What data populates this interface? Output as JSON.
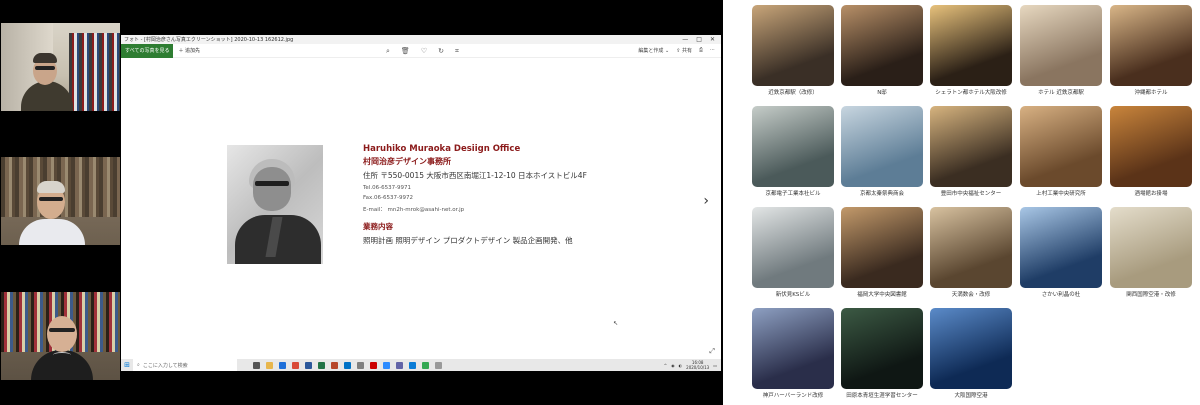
{
  "photos_window": {
    "title": "フォト - [村岡治彦さん写真エクリーンショット] 2020-10-13 162612.jpg",
    "all_photos_label": "すべての写真を見る",
    "add_label": "＋ 追加先",
    "edit_label": "編集と作成 ⌄",
    "share_label": "⇪ 共有",
    "minimize": "—",
    "maximize": "□",
    "close": "✕"
  },
  "card": {
    "name_en": "Haruhiko Muraoka Desiign Office",
    "name_jp": "村岡治彦デザイン事務所",
    "address": "住所 〒550-0015 大阪市西区南堀江1-12-10 日本ホイストビル4F",
    "tel": "Tel.06-6537-9971",
    "fax": "Fax.06-6537-9972",
    "email": "E-mail： mn2h-mrok@asahi-net.or.jp",
    "section_title": "業務内容",
    "business": "照明計画 照明デザイン プロダクトデザイン 製品企画開発、他"
  },
  "taskbar": {
    "search_placeholder": "ここに入力して検索",
    "time": "16:08",
    "date": "2020/10/13"
  },
  "gallery": {
    "items": [
      {
        "caption": "近鉄京都駅（改修）",
        "c1": "#3a2f26",
        "c2": "#c9a67a"
      },
      {
        "caption": "N邸",
        "c1": "#2a1f18",
        "c2": "#b89068"
      },
      {
        "caption": "シェラトン都ホテル大阪改修",
        "c1": "#2b2016",
        "c2": "#e8c27c"
      },
      {
        "caption": "ホテル 近鉄京都駅",
        "c1": "#8a7560",
        "c2": "#e7d8c0"
      },
      {
        "caption": "沖縄都ホテル",
        "c1": "#4a2f1e",
        "c2": "#d9b688"
      },
      {
        "caption": "京都電子工業本社ビル",
        "c1": "#4b5a5a",
        "c2": "#c6cdc9"
      },
      {
        "caption": "京都太秦祭典商会",
        "c1": "#5d7d96",
        "c2": "#c8d6e0"
      },
      {
        "caption": "豊田市中央福祉センター",
        "c1": "#3b2e22",
        "c2": "#d7b47f"
      },
      {
        "caption": "上村工業中央研究所",
        "c1": "#6b4a2c",
        "c2": "#d8b183"
      },
      {
        "caption": "酒場館お掛場",
        "c1": "#5b3318",
        "c2": "#c9853c"
      },
      {
        "caption": "新伏見KSビル",
        "c1": "#707a7e",
        "c2": "#e3e6e6"
      },
      {
        "caption": "福岡大学中央図書館",
        "c1": "#3a2a1f",
        "c2": "#c39a6b"
      },
      {
        "caption": "天満数会・改修",
        "c1": "#5a4630",
        "c2": "#d8c2a0"
      },
      {
        "caption": "さかい利晶の杜",
        "c1": "#1f3d66",
        "c2": "#a9c7e6"
      },
      {
        "caption": "関西国際空港・改修",
        "c1": "#a89b7e",
        "c2": "#e4ddcb"
      },
      {
        "caption": "神戸ハーバーランド改修",
        "c1": "#2a2e4a",
        "c2": "#8ea0c2"
      },
      {
        "caption": "田原本青垣生涯学習センター",
        "c1": "#0f1714",
        "c2": "#3c5a44"
      },
      {
        "caption": "大阪国際空港",
        "c1": "#0e2a55",
        "c2": "#5b8bc9"
      }
    ]
  },
  "colors": {
    "accent_green": "#2e7d32",
    "card_red": "#8b1a1a"
  }
}
